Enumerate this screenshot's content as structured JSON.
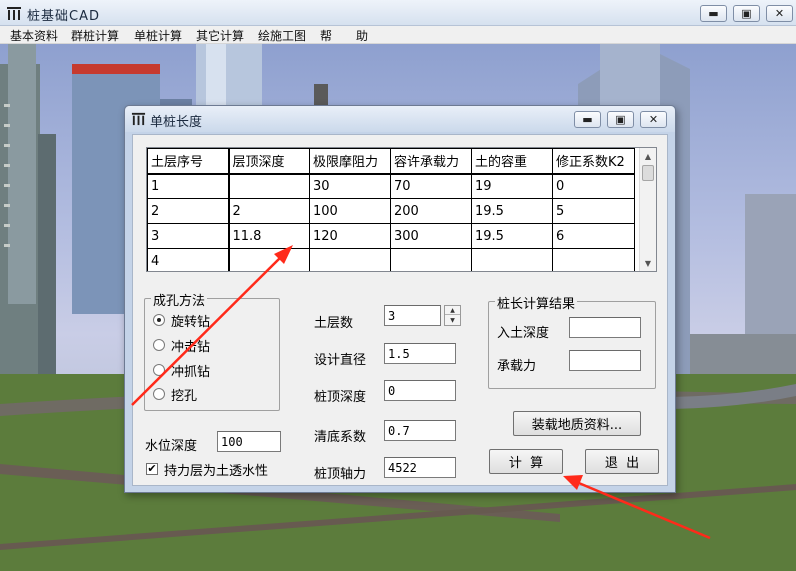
{
  "app": {
    "title": "桩基础CAD",
    "menu": [
      "基本资料",
      "群桩计算",
      "单桩计算",
      "其它计算",
      "绘施工图",
      "帮",
      "助"
    ]
  },
  "dialog": {
    "title": "单桩长度",
    "grid": {
      "columns": [
        "土层序号",
        "层顶深度",
        "极限摩阻力",
        "容许承载力",
        "土的容重",
        "修正系数K2"
      ],
      "rows": [
        [
          "1",
          "",
          "30",
          "70",
          "19",
          "0"
        ],
        [
          "2",
          "2",
          "100",
          "200",
          "19.5",
          "5"
        ],
        [
          "3",
          "11.8",
          "120",
          "300",
          "19.5",
          "6"
        ],
        [
          "4",
          "",
          "",
          "",
          "",
          ""
        ]
      ]
    },
    "method": {
      "legend": "成孔方法",
      "options": [
        "旋转钻",
        "冲击钻",
        "冲抓钻",
        "挖孔"
      ],
      "selected_index": 0
    },
    "water_depth": {
      "label": "水位深度",
      "value": "100"
    },
    "bearing_layer": {
      "label": "持力层为土透水性",
      "checked": true,
      "mark": "✔"
    },
    "fields": [
      {
        "label": "土层数",
        "value": "3"
      },
      {
        "label": "设计直径",
        "value": "1.5"
      },
      {
        "label": "桩顶深度",
        "value": "0"
      },
      {
        "label": "清底系数",
        "value": "0.7"
      },
      {
        "label": "桩顶轴力",
        "value": "4522"
      }
    ],
    "result": {
      "legend": "桩长计算结果",
      "depth_label": "入土深度",
      "depth_value": "",
      "capacity_label": "承载力",
      "capacity_value": ""
    },
    "buttons": {
      "load": "装载地质资料...",
      "compute": "计  算",
      "exit": "退  出"
    }
  },
  "colors": {
    "annotation_arrow": "#ff2a1a",
    "titlebar": "#d6e1ef"
  }
}
